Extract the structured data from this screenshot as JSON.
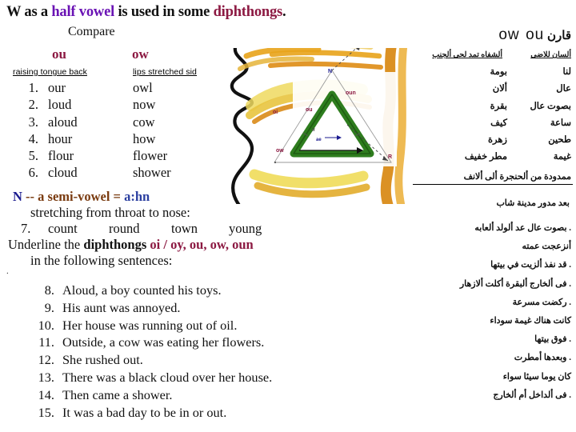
{
  "title": {
    "part1": "W as a ",
    "highlight1": "half vowel",
    "part2": " is used in some ",
    "highlight2": "diphthongs",
    "part3": "."
  },
  "compare_label": "Compare",
  "columns": {
    "left_header": "ou",
    "right_header": "ow",
    "left_subhead": "raising tongue back",
    "right_subhead": "lips stretched sid"
  },
  "word_rows": [
    {
      "num": "1.",
      "ou": "our",
      "ow": "owl"
    },
    {
      "num": "2.",
      "ou": "loud",
      "ow": "now"
    },
    {
      "num": "3.",
      "ou": "aloud",
      "ow": "cow"
    },
    {
      "num": "4.",
      "ou": "hour",
      "ow": "how"
    },
    {
      "num": "5.",
      "ou": "flour",
      "ow": "flower"
    },
    {
      "num": "6.",
      "ou": "cloud",
      "ow": "shower"
    }
  ],
  "semivowel": {
    "letter": "N",
    "desc": " -- a semi-vowel = ",
    "phonetic": "a:hn",
    "stretching": "stretching from throat to nose:",
    "row7_num": "7.",
    "row7_words": [
      "count",
      "round",
      "town",
      "young"
    ],
    "underline_prefix": "Underline the ",
    "underline_bold": "diphthongs",
    "underline_list": " oi / oy, ou, ow, oun",
    "following": "in the following sentences:"
  },
  "sentences": [
    {
      "num": "8.",
      "text": "Aloud, a boy counted his toys."
    },
    {
      "num": "9.",
      "text": "His aunt was annoyed."
    },
    {
      "num": "10.",
      "text": "Her house was running out of oil."
    },
    {
      "num": "11.",
      "text": "Outside, a cow was eating her flowers."
    },
    {
      "num": "12.",
      "text": "She rushed out."
    },
    {
      "num": "13.",
      "text": "There was a black cloud over her house."
    },
    {
      "num": "14.",
      "text": "Then came a shower."
    },
    {
      "num": "15.",
      "text": "It was a bad day to be in or out."
    }
  ],
  "arabic": {
    "title_word": "قارن",
    "title_ou": "ou",
    "title_ow": "ow",
    "head_right": "ألسان للاضى",
    "head_left": "ألشفاه تمد لحى ألجنب",
    "rows": [
      {
        "right": "لنا",
        "left": "بومة"
      },
      {
        "right": "عال",
        "left": "ألان"
      },
      {
        "right": "بصوت عال",
        "left": "بقرة"
      },
      {
        "right": "ساعة",
        "left": "كيف"
      },
      {
        "right": "طحين",
        "left": "زهرة"
      },
      {
        "right": "غيمة",
        "left": "مطر خفيف"
      }
    ],
    "note1": "ممدودة من ألحنجرة ألى ألانف",
    "note2": "بعد مدور مدينة شاب",
    "sentences": [
      "بصوت عال عد ألولد ألعابه .",
      "أنزعجت عمته",
      "قد نفذ ألزيت في بيتها .",
      "فى ألخارج ألبقرة أكلت ألازهار .",
      "ركضت مسرعة .",
      "كانت هناك غيمة سوداء",
      "فوق بيتها .",
      "وبعدها أمطرت .",
      "كان يوما سيئا سواء",
      "فى ألداخل أم ألخارج ."
    ]
  },
  "diagram": {
    "label_n": "N",
    "label_oun": "oun",
    "label_oi": "oi",
    "label_ou": "ou",
    "label_ow": "ow",
    "label_r": "R",
    "label_ir": "ir",
    "label_ae": "ae"
  },
  "colors": {
    "purple": "#6a13b4",
    "crimson": "#8c1942",
    "brown": "#7a3b10",
    "navy": "#1b1b8f",
    "green": "#2e7d1e",
    "gold": "#e8a31a",
    "yellow": "#e8d24a"
  }
}
